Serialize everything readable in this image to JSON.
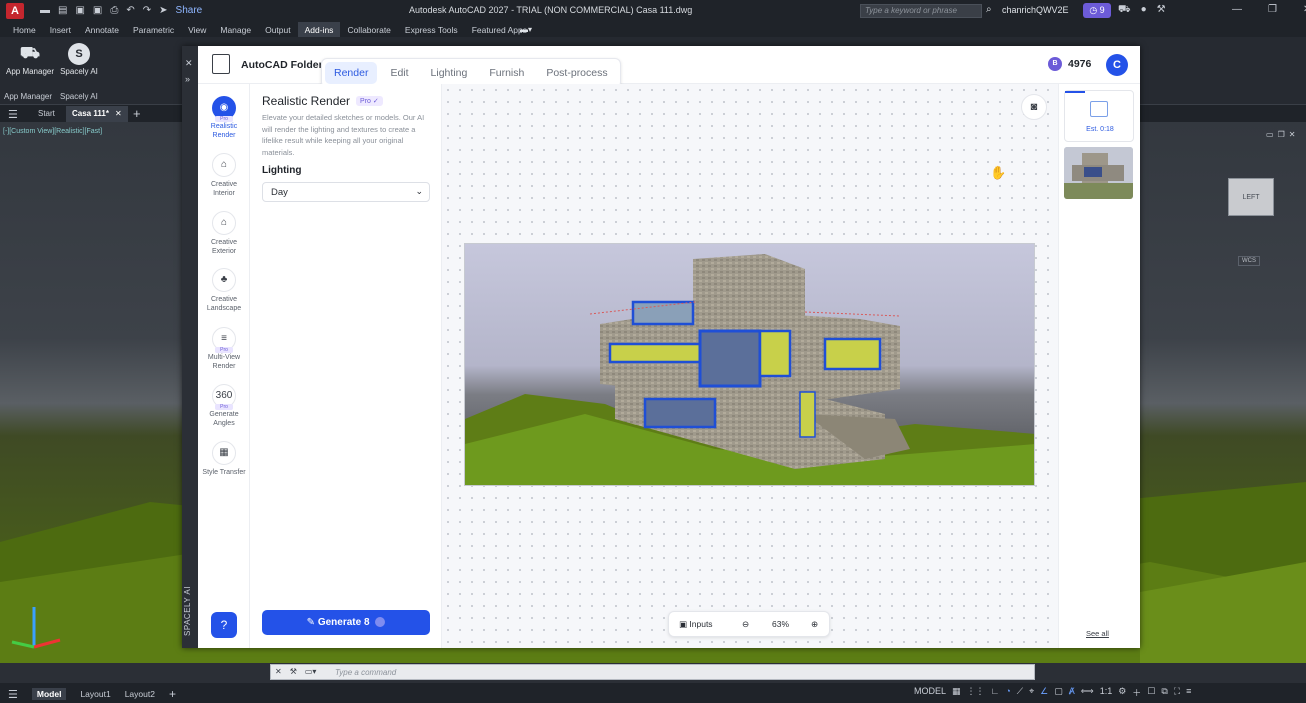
{
  "app": {
    "logo": "A",
    "title": "Autodesk AutoCAD 2027 - TRIAL (NON COMMERCIAL)    Casa 111.dwg",
    "share": "Share",
    "search_placeholder": "Type a keyword or phrase",
    "user": "chanrichQWV2E",
    "notif_count": "9"
  },
  "ribbon_tabs": [
    "Home",
    "Insert",
    "Annotate",
    "Parametric",
    "View",
    "Manage",
    "Output",
    "Add-ins",
    "Collaborate",
    "Express Tools",
    "Featured Apps"
  ],
  "active_ribbon_tab": "Add-ins",
  "ribbon": {
    "app_manager": "App Manager",
    "spacely": "Spacely AI",
    "group_app_manager": "App Manager",
    "group_spacely": "Spacely AI"
  },
  "doc_tabs": {
    "start": "Start",
    "current": "Casa 111*"
  },
  "viewport": {
    "view_label": "[-][Custom View][Realistic][Fast]",
    "navcube_label": "LEFT",
    "wcs": "WCS"
  },
  "panel": {
    "strip_label": "SPACELY AI",
    "folder": "AutoCAD Folder",
    "tabs": [
      "Render",
      "Edit",
      "Lighting",
      "Furnish",
      "Post-process"
    ],
    "selected_tab": "Render",
    "credits": "4976",
    "credit_symbol": "B",
    "avatar": "C",
    "tools": [
      {
        "label": "Realistic Render",
        "icon": "◉",
        "pro": true,
        "active": true
      },
      {
        "label": "Creative Interior",
        "icon": "⌂",
        "pro": false,
        "active": false
      },
      {
        "label": "Creative Exterior",
        "icon": "⌂",
        "pro": false,
        "active": false
      },
      {
        "label": "Creative Landscape",
        "icon": "♣",
        "pro": false,
        "active": false
      },
      {
        "label": "Multi-View Render",
        "icon": "≡",
        "pro": true,
        "active": false
      },
      {
        "label": "Generate Angles",
        "icon": "360",
        "pro": true,
        "active": false
      },
      {
        "label": "Style Transfer",
        "icon": "▦",
        "pro": false,
        "active": false
      }
    ],
    "pro_label": "Pro",
    "help": "?",
    "settings": {
      "heading": "Realistic Render",
      "pro_badge": "Pro ✓",
      "description": "Elevate your detailed sketches or models. Our AI will render the lighting and textures to create a lifelike result while keeping all your original materials.",
      "lighting_label": "Lighting",
      "lighting_value": "Day"
    },
    "generate": "Generate 8",
    "zoom": {
      "inputs": "Inputs",
      "level": "63%"
    },
    "history": {
      "estimate": "Est. 0:18",
      "see_all": "See all"
    }
  },
  "command": {
    "placeholder": "Type a command"
  },
  "status": {
    "tabs": [
      "Model",
      "Layout1",
      "Layout2"
    ],
    "active_tab": "Model",
    "mode": "MODEL",
    "scale": "1:1"
  }
}
